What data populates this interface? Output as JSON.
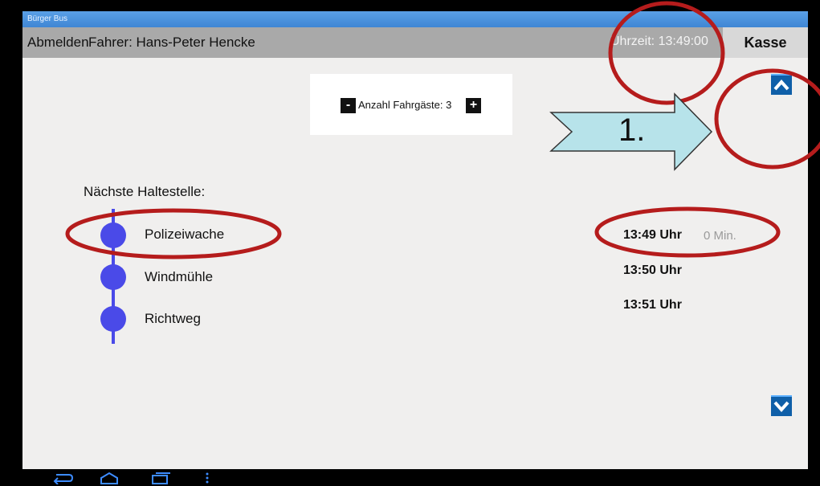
{
  "window": {
    "title": "Bürger Bus"
  },
  "header": {
    "logout_label": "Abmelden",
    "driver_text": "Fahrer: Hans-Peter Hencke",
    "clock_text": "Uhrzeit: 13:49:00",
    "kasse_label": "Kasse"
  },
  "passengers": {
    "minus_label": "-",
    "plus_label": "+",
    "count_text": "Anzahl Fahrgäste: 3"
  },
  "route": {
    "next_stop_label": "Nächste Haltestelle:",
    "stops": [
      {
        "name": "Polizeiwache",
        "time": "13:49 Uhr",
        "delay": "0 Min."
      },
      {
        "name": "Windmühle",
        "time": "13:50 Uhr"
      },
      {
        "name": "Richtweg",
        "time": "13:51 Uhr"
      }
    ]
  },
  "navigation": {
    "up_icon": "chevron-up-icon",
    "down_icon": "chevron-down-icon"
  },
  "android_nav": {
    "icons": [
      "back-icon",
      "home-icon",
      "recent-apps-icon",
      "menu-icon"
    ]
  },
  "annotation": {
    "step_label": "1.",
    "highlight_color": "#b51c1c",
    "arrow_color": "#b7e3ea"
  },
  "colors": {
    "route": "#4a4ae8",
    "header": "#a9a9a9",
    "content": "#f0efee",
    "button": "#0f5fa8"
  }
}
